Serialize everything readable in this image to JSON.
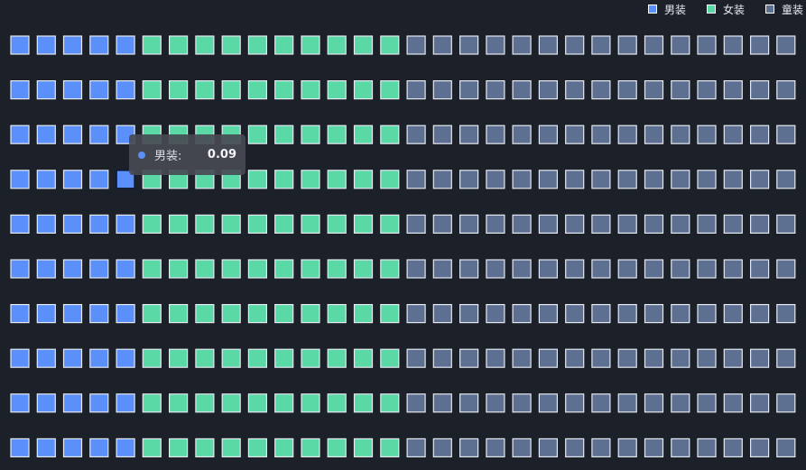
{
  "chart_data": {
    "type": "grid",
    "rows": 10,
    "columns": 30,
    "series": [
      {
        "name": "男装",
        "columns_per_row": 5,
        "color": "#5b8ff9"
      },
      {
        "name": "女装",
        "columns_per_row": 10,
        "color": "#5ad8a6"
      },
      {
        "name": "童装",
        "columns_per_row": 15,
        "color": "#5d7092"
      }
    ],
    "legend_position": "top-right"
  },
  "tooltip": {
    "name": "男装:",
    "value": "0.09",
    "color": "#5b8ff9",
    "highlighted_row": 4,
    "highlighted_column": 5
  }
}
